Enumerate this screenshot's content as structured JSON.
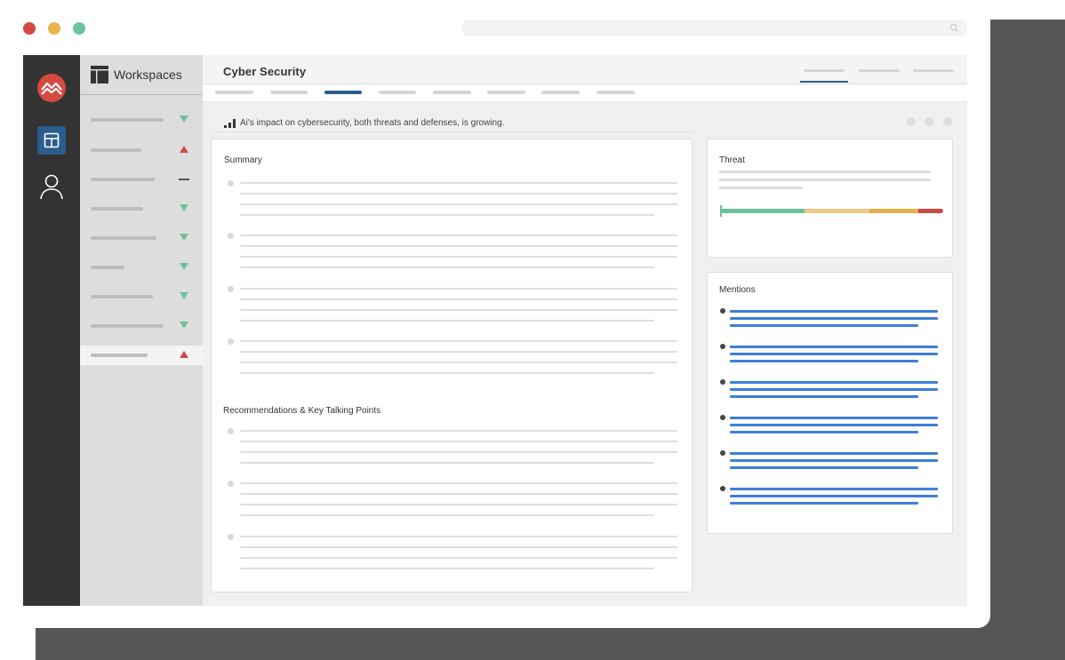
{
  "window": {
    "controls": [
      {
        "name": "close",
        "color": "#d44a40"
      },
      {
        "name": "minimize",
        "color": "#e9b64c"
      },
      {
        "name": "maximize",
        "color": "#6cc3a0"
      }
    ]
  },
  "colors": {
    "accent": "#2b5d8e",
    "rail": "#333333",
    "sidebar": "#dddddd",
    "trend_down": "#6dbf9a",
    "trend_up": "#cc4b47",
    "mention_link": "#3f7ed8"
  },
  "rail": {
    "logo": "mountain-logo-icon",
    "items": [
      {
        "icon": "dashboard-grid-icon",
        "active": true
      },
      {
        "icon": "user-icon",
        "active": false
      }
    ]
  },
  "sidebar": {
    "title": "Workspaces",
    "icon": "workspaces-icon",
    "items": [
      {
        "trend": "down"
      },
      {
        "trend": "up"
      },
      {
        "trend": "flat"
      },
      {
        "trend": "down"
      },
      {
        "trend": "down"
      },
      {
        "trend": "down"
      },
      {
        "trend": "down"
      },
      {
        "trend": "down"
      },
      {
        "trend": "up",
        "active": true
      }
    ]
  },
  "header": {
    "title": "Cyber Security"
  },
  "headline": {
    "icon": "signal-bars-icon",
    "text": "Ai's impact on cybersecurity, both threats and defenses, is growing."
  },
  "summary": {
    "title": "Summary"
  },
  "recommendations": {
    "title": "Recommendations & Key Talking Points"
  },
  "threat": {
    "title": "Threat",
    "level": 0.0,
    "segments": [
      {
        "share": 0.38,
        "color": "#6dbf9a"
      },
      {
        "share": 0.29,
        "color": "#edc98b"
      },
      {
        "share": 0.22,
        "color": "#e0b14c"
      },
      {
        "share": 0.11,
        "color": "#cc4b47"
      }
    ]
  },
  "mentions": {
    "title": "Mentions"
  }
}
